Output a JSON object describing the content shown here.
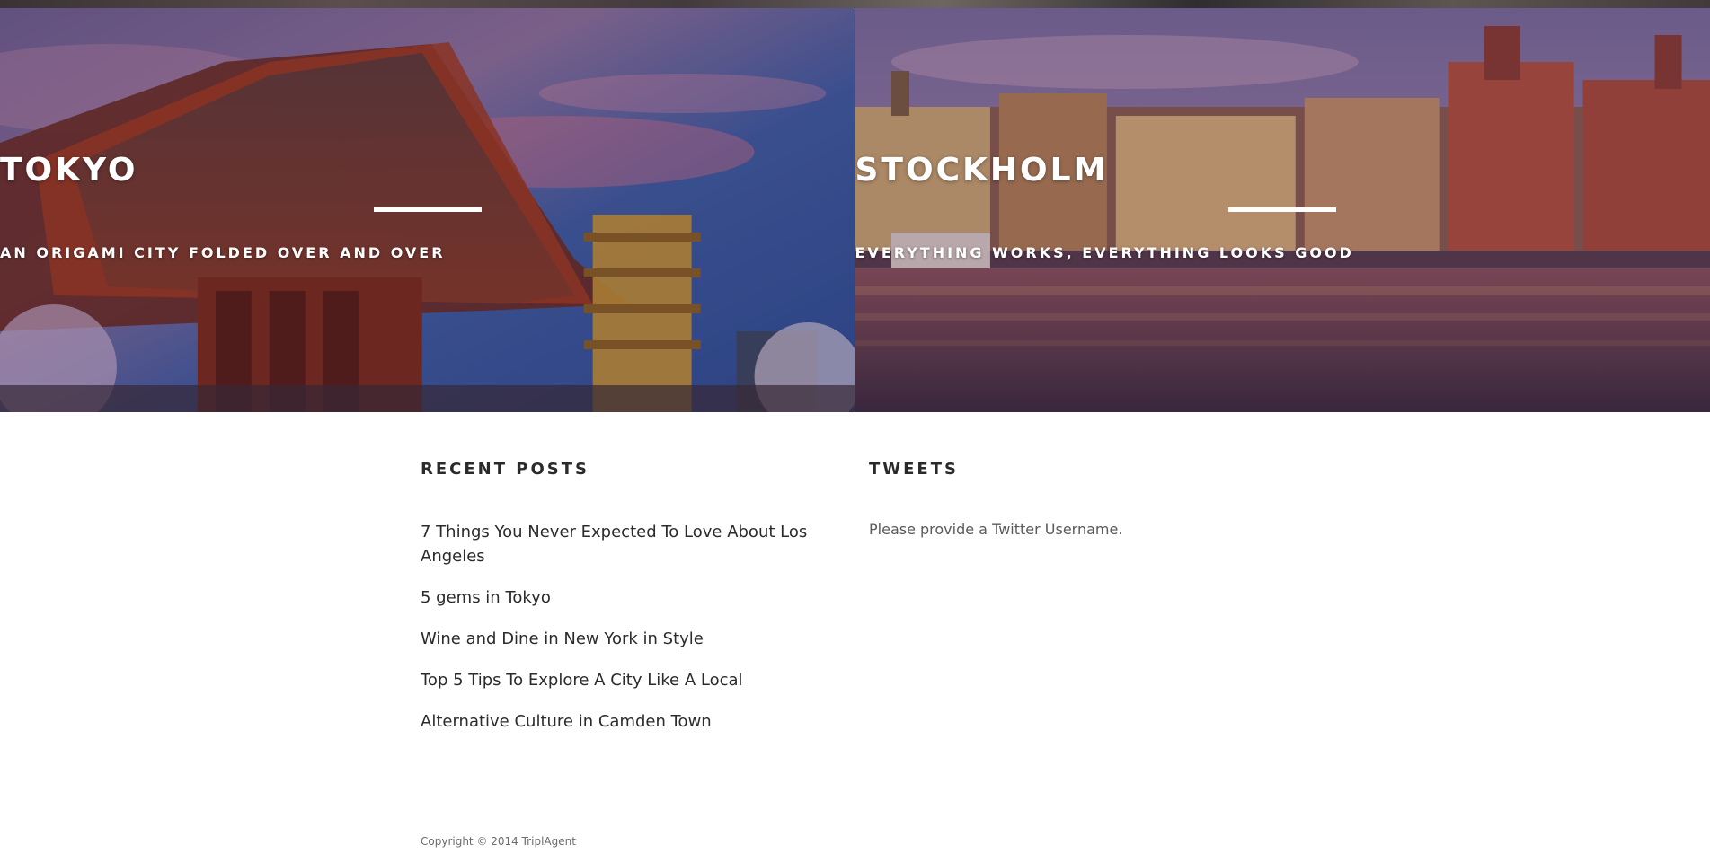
{
  "heroes": [
    {
      "title": "TOKYO",
      "subtitle": "AN ORIGAMI CITY FOLDED OVER AND OVER"
    },
    {
      "title": "STOCKHOLM",
      "subtitle": "EVERYTHING WORKS, EVERYTHING LOOKS GOOD"
    }
  ],
  "recent_posts": {
    "title": "RECENT POSTS",
    "items": [
      "7 Things You Never Expected To Love About Los Angeles",
      "5 gems in Tokyo",
      "Wine and Dine in New York in Style",
      "Top 5 Tips To Explore A City Like A Local",
      "Alternative Culture in Camden Town"
    ]
  },
  "tweets": {
    "title": "TWEETS",
    "message": "Please provide a Twitter Username."
  },
  "footer": {
    "copyright": "Copyright © 2014 TriplAgent"
  }
}
